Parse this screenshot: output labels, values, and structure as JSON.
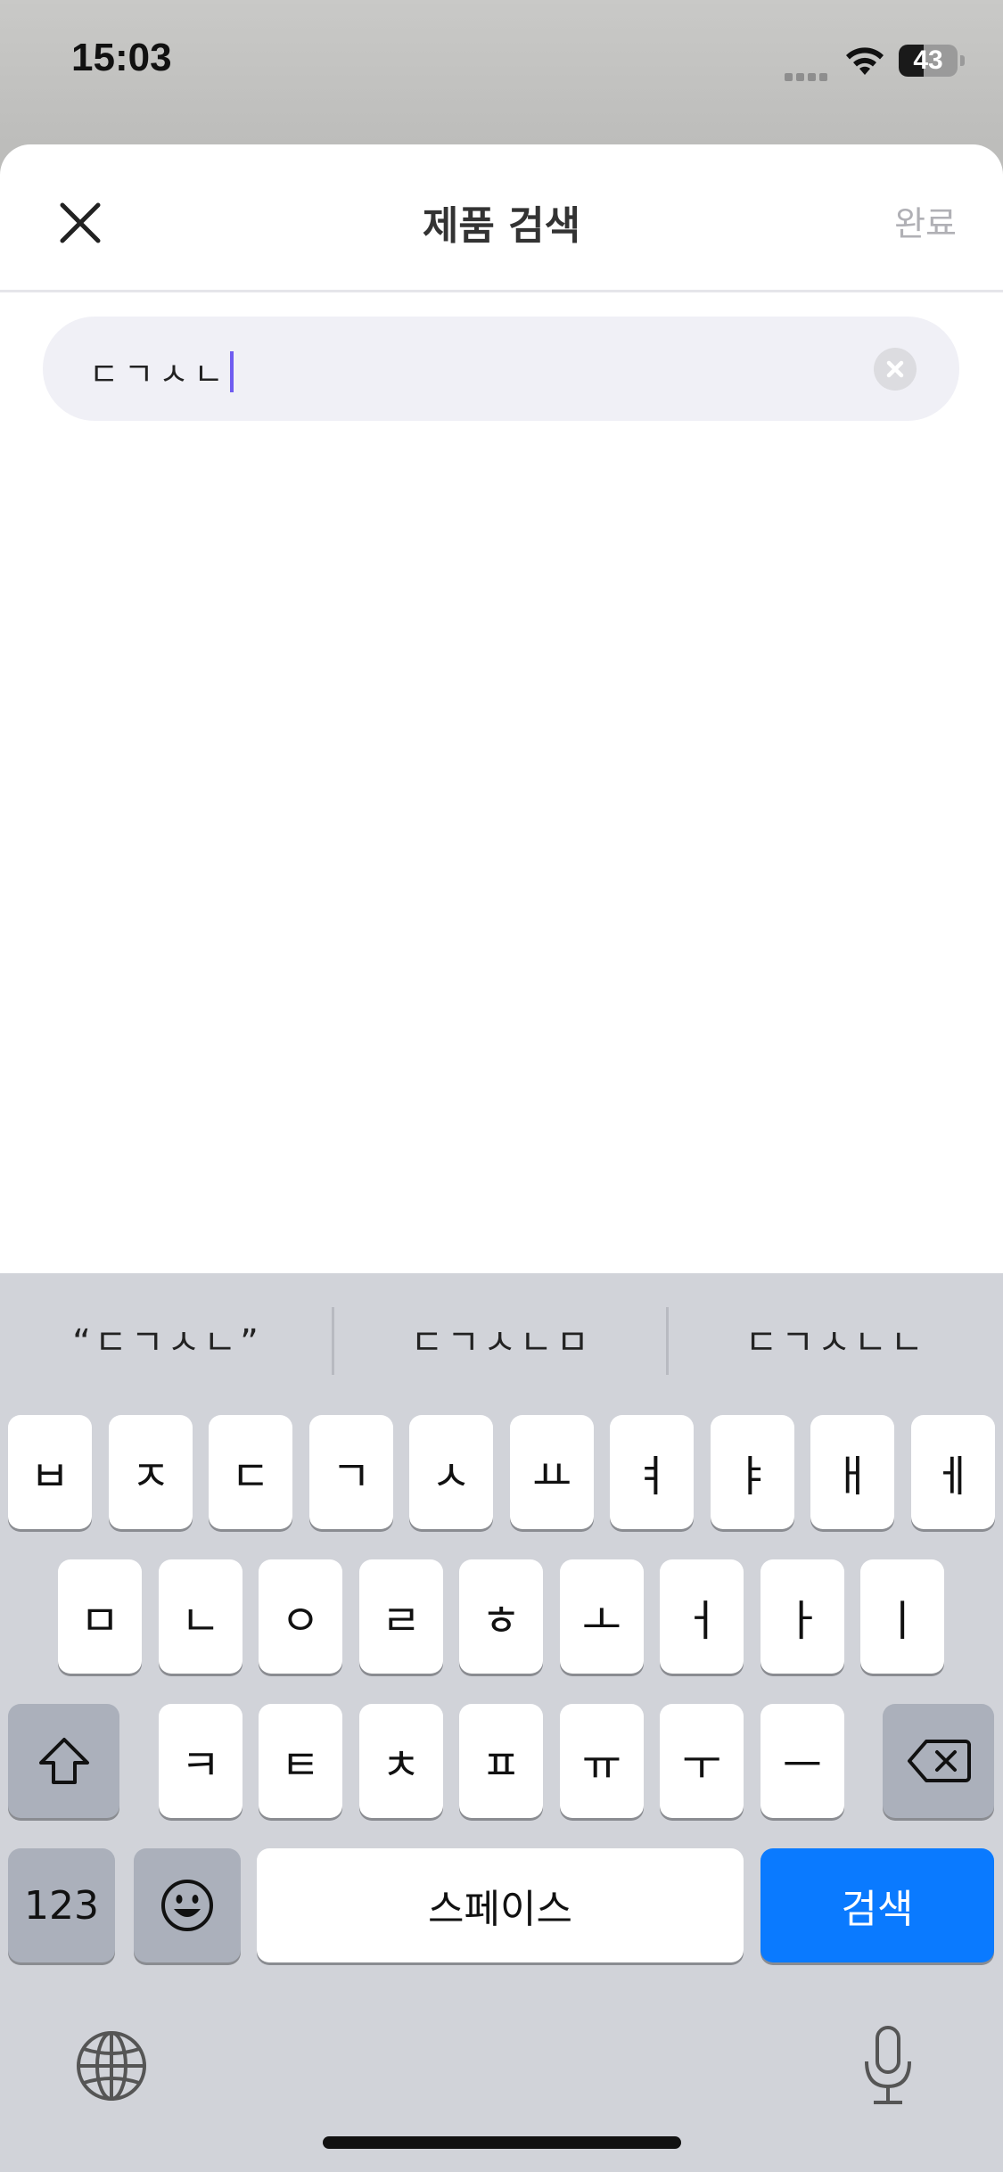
{
  "status_bar": {
    "time": "15:03",
    "battery_level": "43"
  },
  "header": {
    "title": "제품 검색",
    "done_label": "완료"
  },
  "search": {
    "value": "ㄷㄱㅅㄴ"
  },
  "keyboard": {
    "suggestions": [
      "“ㄷㄱㅅㄴ”",
      "ㄷㄱㅅㄴㅁ",
      "ㄷㄱㅅㄴㄴ"
    ],
    "row1": [
      "ㅂ",
      "ㅈ",
      "ㄷ",
      "ㄱ",
      "ㅅ",
      "ㅛ",
      "ㅕ",
      "ㅑ",
      "ㅐ",
      "ㅔ"
    ],
    "row2": [
      "ㅁ",
      "ㄴ",
      "ㅇ",
      "ㄹ",
      "ㅎ",
      "ㅗ",
      "ㅓ",
      "ㅏ",
      "ㅣ"
    ],
    "row3": [
      "ㅋ",
      "ㅌ",
      "ㅊ",
      "ㅍ",
      "ㅠ",
      "ㅜ",
      "ㅡ"
    ],
    "numbers_label": "123",
    "space_label": "스페이스",
    "search_label": "검색"
  },
  "colors": {
    "accent_caret": "#6f5cf0",
    "search_key": "#0a7aff"
  }
}
